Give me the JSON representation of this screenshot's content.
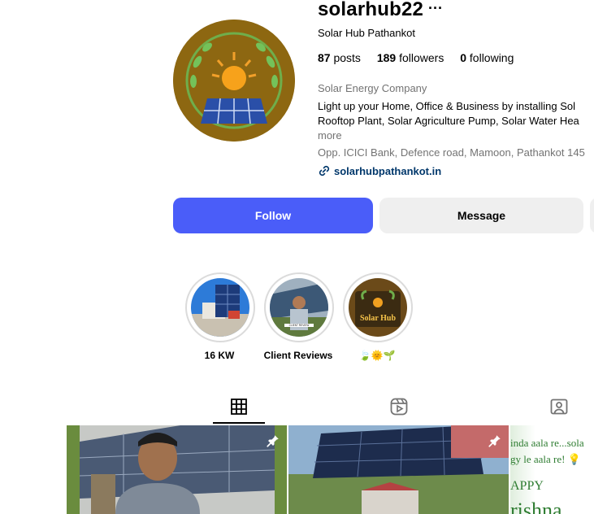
{
  "profile": {
    "username": "solarhub22",
    "more": "···",
    "full_name": "Solar Hub Pathankot",
    "stats": {
      "posts_count": "87",
      "posts_label": "posts",
      "followers_count": "189",
      "followers_label": "followers",
      "following_count": "0",
      "following_label": "following"
    },
    "category": "Solar Energy Company",
    "bio_line1": "Light up your Home, Office & Business by installing Sol",
    "bio_line2": "Rooftop Plant, Solar Agriculture Pump, Solar Water Hea",
    "bio_more": "more",
    "address": "Opp. ICICI Bank, Defence road, Mamoon, Pathankot 145",
    "website": "solarhubpathankot.in"
  },
  "actions": {
    "follow_label": "Follow",
    "message_label": "Message"
  },
  "highlights": [
    {
      "label": "16 KW"
    },
    {
      "label": "Client Reviews"
    },
    {
      "label": "🍃🌞🌱"
    }
  ],
  "highlight_image_text": {
    "client_reviews_caption": "CLIENT REVIEW",
    "solar_hub_logo": "Solar Hub"
  },
  "tabs": [
    {
      "icon": "grid-icon",
      "active": true
    },
    {
      "icon": "reels-icon",
      "active": false
    },
    {
      "icon": "tagged-icon",
      "active": false
    }
  ],
  "posts": [
    {
      "icon": "pin-icon",
      "pinned": true
    },
    {
      "icon": "pin-icon",
      "pinned": true
    },
    {
      "pinned": false,
      "text_line1": "inda aala re...sola",
      "text_line2": "gy le aala re! 💡",
      "text_line3": "APPY",
      "text_line4": "rishna"
    }
  ],
  "colors": {
    "follow_button": "#4a5df9",
    "message_button": "#efefef",
    "link": "#00376b",
    "secondary_text": "#737373"
  }
}
